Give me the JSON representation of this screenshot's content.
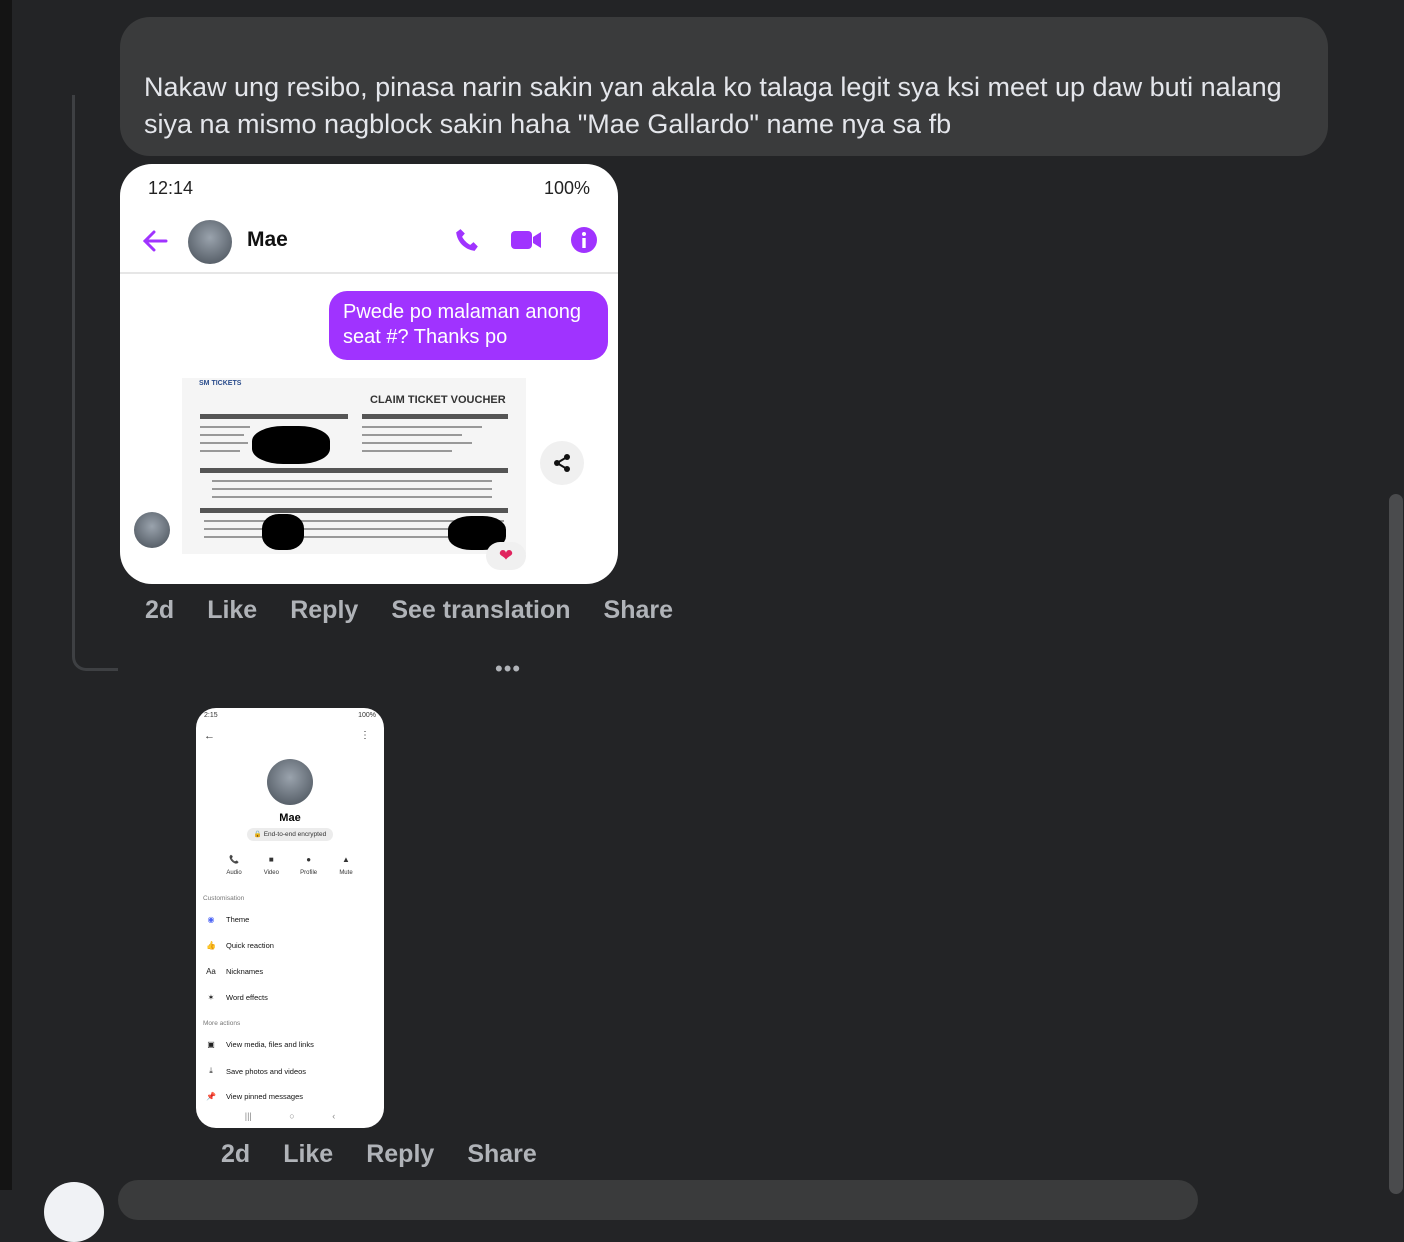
{
  "comment": {
    "text": "Nakaw ung resibo, pinasa narin sakin yan akala ko talaga legit sya ksi meet up daw buti nalang siya na mismo nagblock sakin haha \"Mae Gallardo\" name nya sa fb"
  },
  "screenshot1": {
    "status_time": "12:14",
    "status_battery": "100%",
    "contact_name": "Mae",
    "message": "Pwede po malaman anong seat #? Thanks po",
    "voucher_logo": "SM TICKETS",
    "voucher_title": "CLAIM TICKET VOUCHER"
  },
  "comment_actions": {
    "age": "2d",
    "like": "Like",
    "reply": "Reply",
    "see_translation": "See translation",
    "share": "Share"
  },
  "more": "•••",
  "screenshot2": {
    "status_time": "2:15",
    "status_battery": "100%",
    "name": "Mae",
    "encrypted": "End-to-end encrypted",
    "actions": [
      "Audio",
      "Video",
      "Profile",
      "Mute"
    ],
    "section_customisation": "Customisation",
    "rows_customisation": [
      "Theme",
      "Quick reaction",
      "Nicknames",
      "Word effects"
    ],
    "section_more": "More actions",
    "rows_more": [
      "View media, files and links",
      "Save photos and videos",
      "View pinned messages"
    ]
  },
  "reply_actions": {
    "age": "2d",
    "like": "Like",
    "reply": "Reply",
    "share": "Share"
  },
  "colors": {
    "background": "#232426",
    "bubble": "#3a3b3c",
    "messenger_purple": "#a033ff"
  }
}
